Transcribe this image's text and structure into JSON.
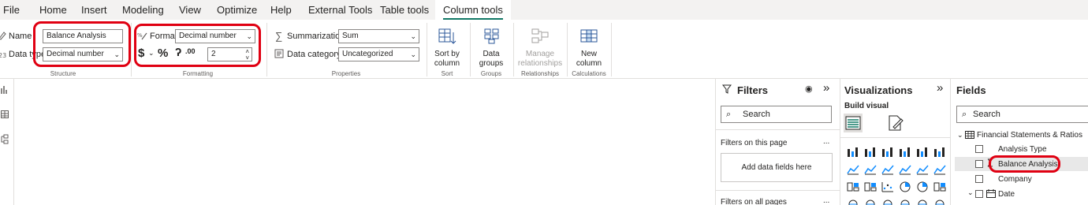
{
  "tabs": [
    {
      "label": "File"
    },
    {
      "label": "Home"
    },
    {
      "label": "Insert"
    },
    {
      "label": "Modeling"
    },
    {
      "label": "View"
    },
    {
      "label": "Optimize"
    },
    {
      "label": "Help"
    },
    {
      "label": "External Tools"
    },
    {
      "label": "Table tools"
    },
    {
      "label": "Column tools"
    }
  ],
  "structure": {
    "name_label": "Name",
    "name_value": "Balance Analysis",
    "datatype_label": "Data type",
    "datatype_value": "Decimal number",
    "group_label": "Structure"
  },
  "formatting": {
    "format_label": "Format",
    "format_value": "Decimal number",
    "currency_symbol": "$",
    "percent_symbol": "%",
    "comma_symbol": "ʔ",
    "decimals_symbol": ".00",
    "decimal_places": "2",
    "group_label": "Formatting"
  },
  "properties": {
    "summarization_label": "Summarization",
    "summarization_value": "Sum",
    "category_label": "Data category",
    "category_value": "Uncategorized",
    "group_label": "Properties"
  },
  "sort": {
    "line1": "Sort by",
    "line2": "column",
    "group_label": "Sort"
  },
  "groups": {
    "line1": "Data",
    "line2": "groups",
    "group_label": "Groups"
  },
  "relationships": {
    "line1": "Manage",
    "line2": "relationships",
    "group_label": "Relationships"
  },
  "calculations": {
    "line1": "New",
    "line2": "column",
    "group_label": "Calculations"
  },
  "filters": {
    "title": "Filters",
    "search_placeholder": "Search",
    "on_this_page": "Filters on this page",
    "add_fields": "Add data fields here",
    "on_all_pages": "Filters on all pages",
    "more": "..."
  },
  "visualizations": {
    "title": "Visualizations",
    "build_visual": "Build visual"
  },
  "fields": {
    "title": "Fields",
    "search_placeholder": "Search",
    "table_name": "Financial Statements & Ratios",
    "items": [
      {
        "label": "Analysis Type"
      },
      {
        "label": "Balance Analysis"
      },
      {
        "label": "Company"
      },
      {
        "label": "Date"
      }
    ]
  },
  "colors": {
    "accent": "#117865",
    "highlight": "#e00012",
    "viz_blue": "#118dff"
  }
}
